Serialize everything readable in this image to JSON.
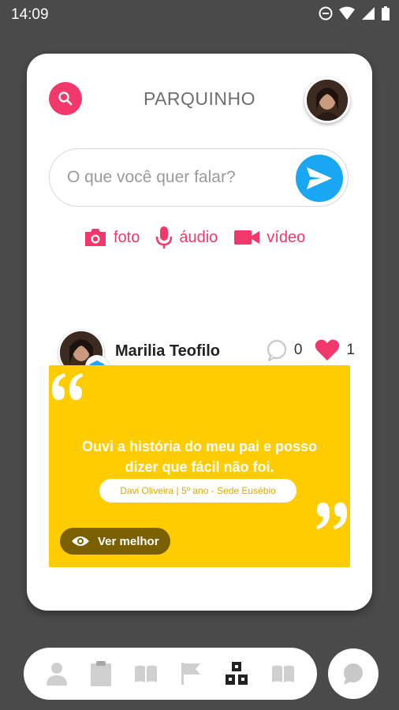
{
  "status": {
    "time": "14:09"
  },
  "header": {
    "title": "PARQUINHO"
  },
  "compose": {
    "placeholder": "O que você quer falar?"
  },
  "media": {
    "photo": "foto",
    "audio": "áudio",
    "video": "vídeo"
  },
  "post": {
    "author": "Marilia Teofilo",
    "comments": "0",
    "likes": "1",
    "quote": "Ouvi a história do meu pai e posso dizer que fácil não foi.",
    "student": "Davi Oliveira  |  5º ano - Sede Eusébio",
    "see_more": "Ver melhor"
  },
  "colors": {
    "accent": "#f0386b",
    "send": "#19a7f3",
    "card": "#ffcc00"
  }
}
